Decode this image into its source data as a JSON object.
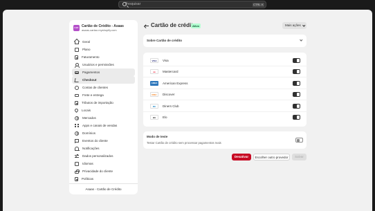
{
  "topbar": {
    "search_placeholder": "Pesquisar",
    "shortcut_key1": "CTRL",
    "shortcut_key2": "K"
  },
  "store": {
    "logo_text": "CdC",
    "name": "Cartão de Crédito - Asaas",
    "url": "asaas-cartao.myshopify.com",
    "logo_color": "#b44fc9"
  },
  "nav": {
    "items": [
      {
        "label": "Geral",
        "icon": "house-icon"
      },
      {
        "label": "Plano",
        "icon": "plan-icon"
      },
      {
        "label": "Faturamento",
        "icon": "billing-icon"
      },
      {
        "label": "Usuários e permissões",
        "icon": "users-icon"
      },
      {
        "label": "Pagamentos",
        "icon": "card-icon"
      },
      {
        "label": "Checkout",
        "icon": "checkout-icon"
      },
      {
        "label": "Contas de clientes",
        "icon": "customer-accounts-icon"
      },
      {
        "label": "Frete e entrega",
        "icon": "truck-icon"
      },
      {
        "label": "Tributos de importação",
        "icon": "tax-icon"
      },
      {
        "label": "Locais",
        "icon": "location-icon"
      },
      {
        "label": "Mercados",
        "icon": "globe-icon"
      },
      {
        "label": "Apps e canais de vendas",
        "icon": "apps-icon"
      },
      {
        "label": "Domínios",
        "icon": "globe-icon"
      },
      {
        "label": "Eventos do cliente",
        "icon": "events-icon"
      },
      {
        "label": "Notificações",
        "icon": "bell-icon"
      },
      {
        "label": "Dados personalizados",
        "icon": "data-icon"
      },
      {
        "label": "Idiomas",
        "icon": "language-icon"
      },
      {
        "label": "Privacidade do cliente",
        "icon": "lock-icon"
      },
      {
        "label": "Políticas",
        "icon": "policy-icon"
      }
    ],
    "footer": "Asaas - Cartão de Crédito"
  },
  "header": {
    "title": "Cartão de crédito",
    "badge": "Ativo",
    "more_actions": "Mais ações"
  },
  "about_section": {
    "label": "Sobre Cartão de crédito"
  },
  "methods": [
    {
      "name": "Visa",
      "logo_text": "VISA",
      "enabled": true
    },
    {
      "name": "Mastercard",
      "logo_text": "●●",
      "enabled": true
    },
    {
      "name": "American Express",
      "logo_text": "AMEX",
      "enabled": true
    },
    {
      "name": "Discover",
      "logo_text": "DISC",
      "enabled": true
    },
    {
      "name": "Diners Club",
      "logo_text": "DC",
      "enabled": true
    },
    {
      "name": "Elo",
      "logo_text": "elo",
      "enabled": true
    }
  ],
  "test_mode": {
    "title": "Modo de teste",
    "description": "Testar Cartão de crédito sem processar pagamentos reais",
    "enabled": false
  },
  "actions": {
    "deactivate": "Desativar",
    "choose_other": "Escolher outro provedor",
    "save": "Salvar"
  },
  "colors": {
    "danger": "#c70a24",
    "badge_bg": "#b4fed2",
    "badge_text": "#0c5132"
  }
}
